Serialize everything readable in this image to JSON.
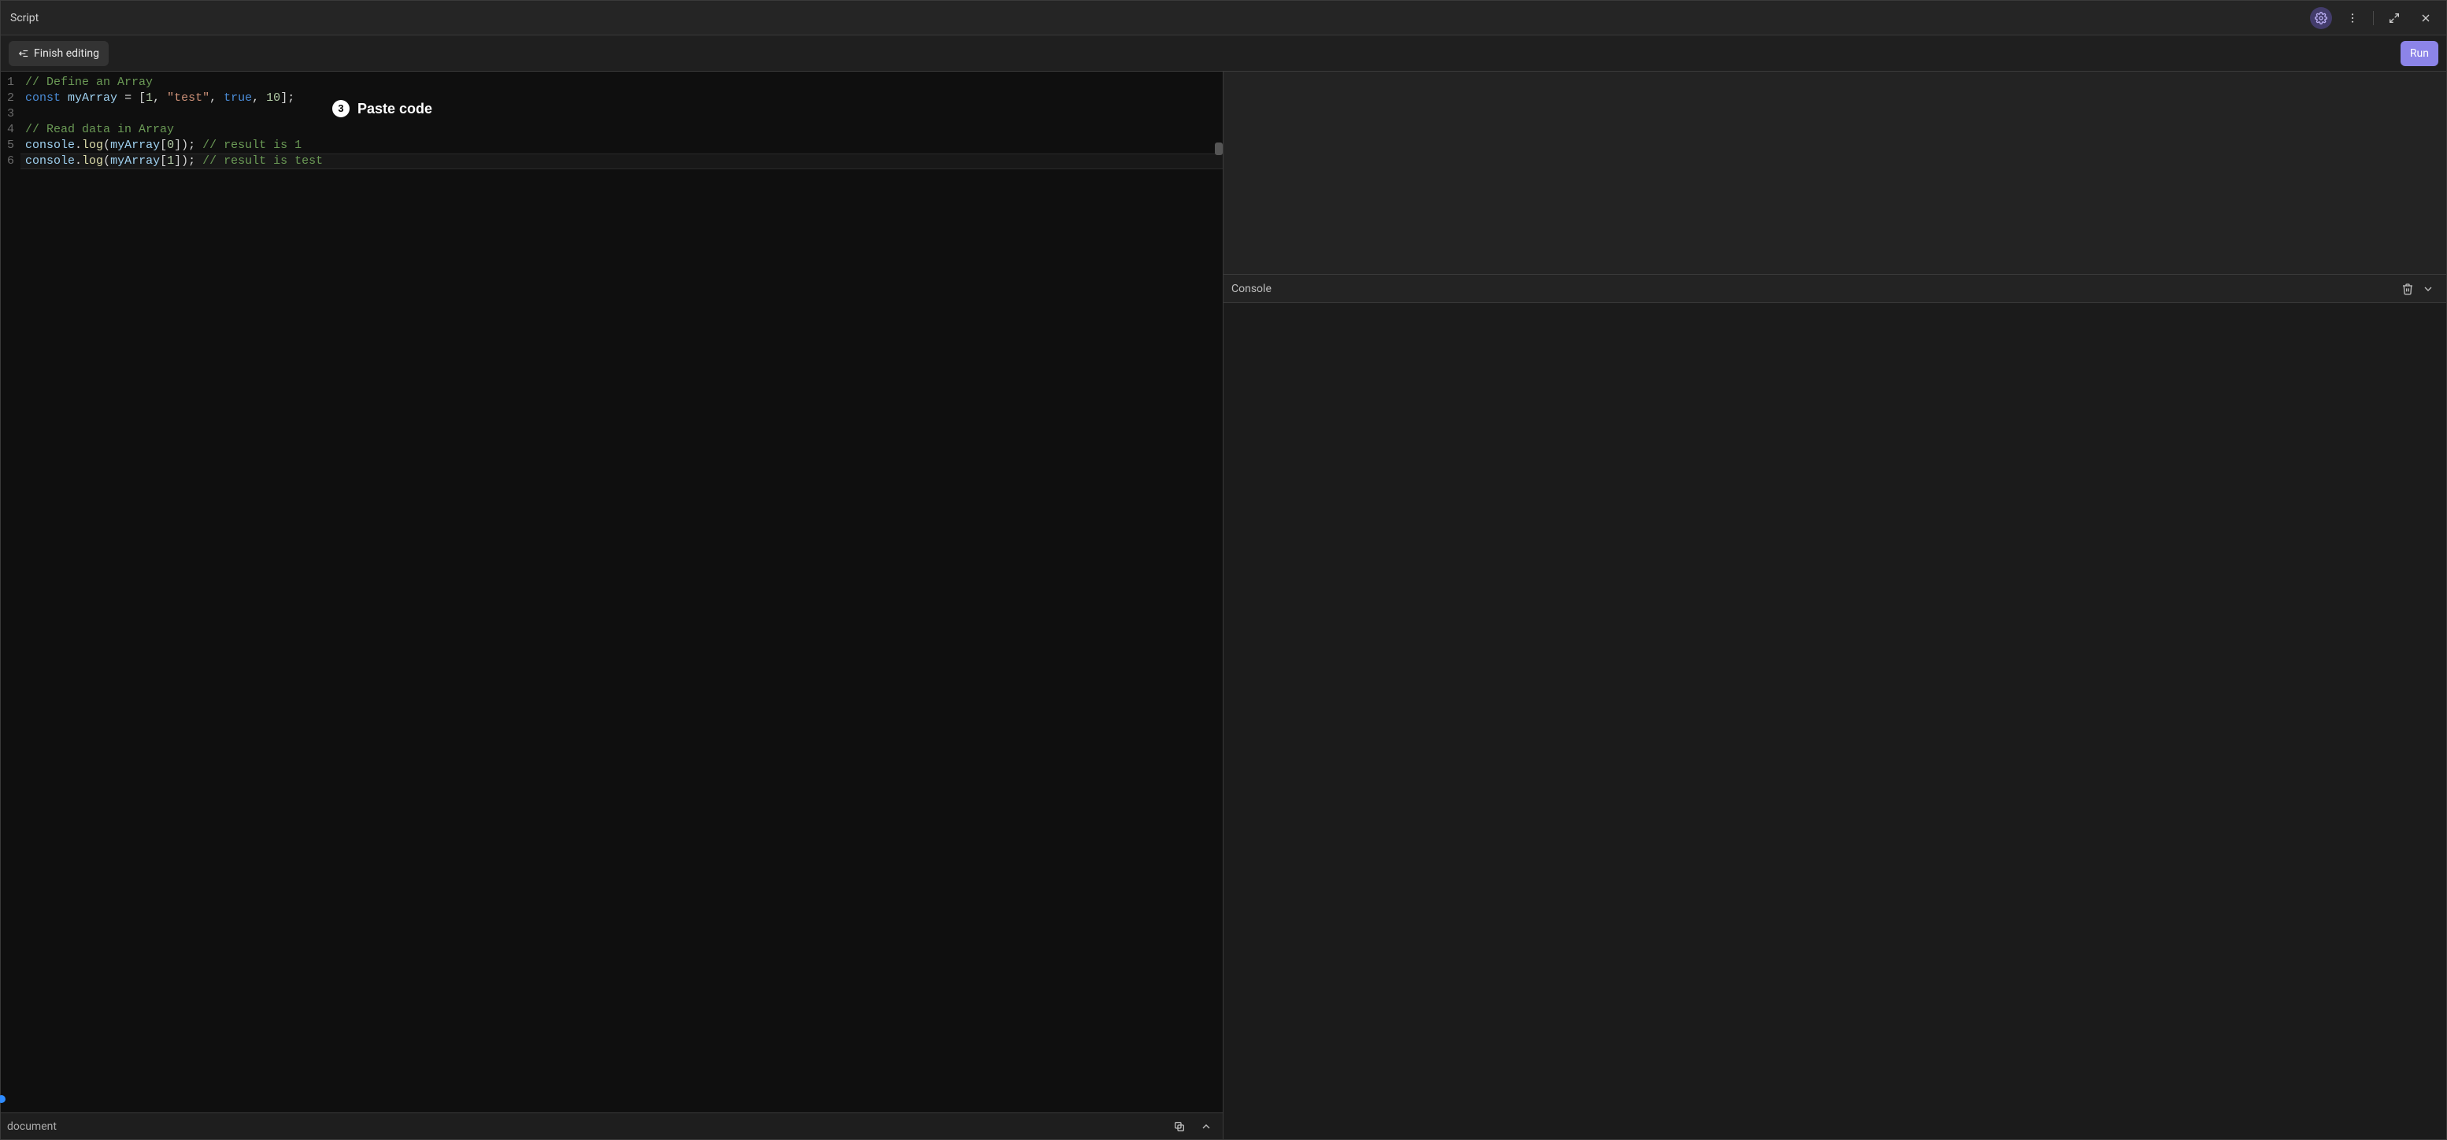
{
  "titlebar": {
    "title": "Script"
  },
  "toolbar": {
    "finish_editing_label": "Finish editing",
    "run_label": "Run"
  },
  "annotation": {
    "number": "3",
    "label": "Paste code"
  },
  "editor": {
    "lines": [
      [
        {
          "cls": "tok-comment",
          "text": "// Define an Array"
        }
      ],
      [
        {
          "cls": "tok-keyword",
          "text": "const"
        },
        {
          "cls": "tok-default",
          "text": " "
        },
        {
          "cls": "tok-ident",
          "text": "myArray"
        },
        {
          "cls": "tok-default",
          "text": " = ["
        },
        {
          "cls": "tok-num",
          "text": "1"
        },
        {
          "cls": "tok-default",
          "text": ", "
        },
        {
          "cls": "tok-str",
          "text": "\"test\""
        },
        {
          "cls": "tok-default",
          "text": ", "
        },
        {
          "cls": "tok-bool",
          "text": "true"
        },
        {
          "cls": "tok-default",
          "text": ", "
        },
        {
          "cls": "tok-num",
          "text": "10"
        },
        {
          "cls": "tok-default",
          "text": "];"
        }
      ],
      [],
      [
        {
          "cls": "tok-comment",
          "text": "// Read data in Array"
        }
      ],
      [
        {
          "cls": "tok-ident",
          "text": "console"
        },
        {
          "cls": "tok-default",
          "text": "."
        },
        {
          "cls": "tok-func",
          "text": "log"
        },
        {
          "cls": "tok-default",
          "text": "("
        },
        {
          "cls": "tok-ident",
          "text": "myArray"
        },
        {
          "cls": "tok-default",
          "text": "["
        },
        {
          "cls": "tok-num",
          "text": "0"
        },
        {
          "cls": "tok-default",
          "text": "]); "
        },
        {
          "cls": "tok-comment",
          "text": "// result is 1"
        }
      ],
      [
        {
          "cls": "tok-ident",
          "text": "console"
        },
        {
          "cls": "tok-default",
          "text": "."
        },
        {
          "cls": "tok-func",
          "text": "log"
        },
        {
          "cls": "tok-default",
          "text": "("
        },
        {
          "cls": "tok-ident",
          "text": "myArray"
        },
        {
          "cls": "tok-default",
          "text": "["
        },
        {
          "cls": "tok-num",
          "text": "1"
        },
        {
          "cls": "tok-default",
          "text": "]); "
        },
        {
          "cls": "tok-comment",
          "text": "// result is test"
        }
      ]
    ],
    "current_line_index": 5
  },
  "statusbar": {
    "context": "document"
  },
  "console": {
    "title": "Console"
  }
}
